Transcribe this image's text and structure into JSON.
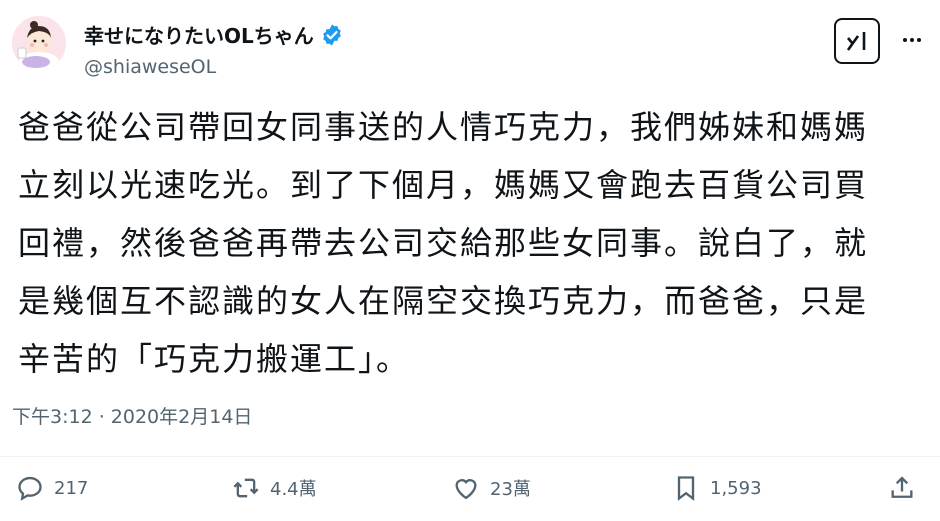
{
  "author": {
    "display_name": "幸せになりたいOLちゃん",
    "handle": "@shiaweseOL",
    "verified_icon": "verified-badge-icon"
  },
  "tweet": {
    "text": "爸爸從公司帶回女同事送的人情巧克力，我們姊妹和媽媽立刻以光速吃光。到了下個月，媽媽又會跑去百貨公司買回禮，然後爸爸再帶去公司交給那些女同事。說白了，就是幾個互不認識的女人在隔空交換巧克力，而爸爸，只是辛苦的「巧克力搬運工」。",
    "timestamp": "下午3:12 · 2020年2月14日"
  },
  "actions": {
    "reply_count": "217",
    "retweet_count": "4.4萬",
    "like_count": "23萬",
    "bookmark_count": "1,593"
  },
  "colors": {
    "verified": "#1d9bf0",
    "text_primary": "#0f1419",
    "text_secondary": "#536471"
  }
}
